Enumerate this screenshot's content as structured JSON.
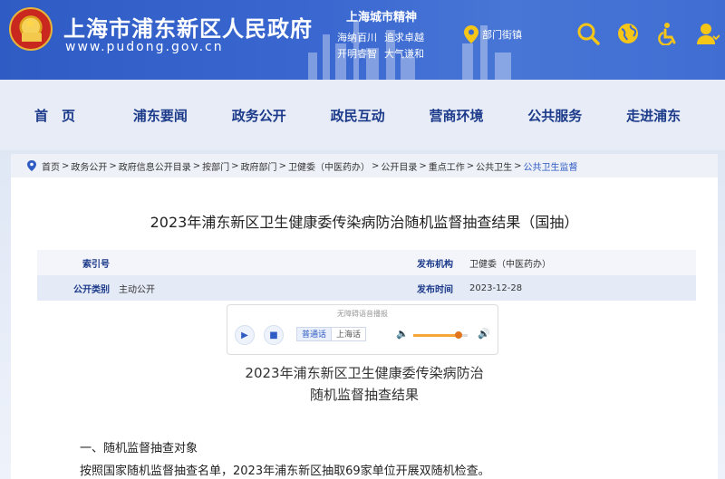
{
  "header": {
    "title": "上海市浦东新区人民政府",
    "url": "www.pudong.gov.cn",
    "spirit_title": "上海城市精神",
    "spirit_lines": [
      [
        "海纳百川",
        "追求卓越"
      ],
      [
        "开明睿智",
        "大气谦和"
      ]
    ],
    "dept_link": "部门街镇",
    "icons": [
      "search-icon",
      "globe-icon",
      "accessibility-icon",
      "user-icon"
    ]
  },
  "nav": {
    "items": [
      "首　页",
      "浦东要闻",
      "政务公开",
      "政民互动",
      "营商环境",
      "公共服务",
      "走进浦东"
    ]
  },
  "breadcrumb": [
    "首页",
    "政务公开",
    "政府信息公开目录",
    "按部门",
    "政府部门",
    "卫健委（中医药办）",
    "公开目录",
    "重点工作",
    "公共卫生",
    "公共卫生监督"
  ],
  "document": {
    "title": "2023年浦东新区卫生健康委传染病防治随机监督抽查结果（国抽）",
    "meta": {
      "index_label": "索引号",
      "index_value": "",
      "publisher_label": "发布机构",
      "publisher_value": "卫健委（中医药办）",
      "category_label": "公开类别",
      "category_value": "主动公开",
      "date_label": "发布时间",
      "date_value": "2023-12-28"
    }
  },
  "player": {
    "title": "无障碍语音播报",
    "lang_standard": "普通话",
    "lang_local": "上海话",
    "volume": 0.8
  },
  "article": {
    "title_line1": "2023年浦东新区卫生健康委传染病防治",
    "title_line2": "随机监督抽查结果",
    "section1": "一、随机监督抽查对象",
    "para1": "按照国家随机监督抽查名单，2023年浦东新区抽取69家单位开展双随机检查。"
  },
  "colors": {
    "header_blue": "#3a68d0",
    "nav_text": "#1c3a8a",
    "accent_orange": "#e2741c"
  }
}
